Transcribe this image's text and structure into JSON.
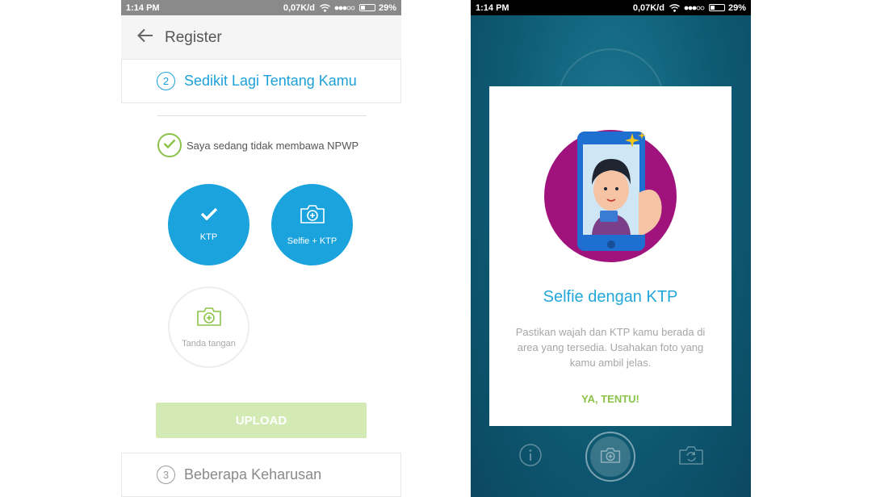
{
  "status_bar": {
    "time": "1:14 PM",
    "speed": "0,07K/d",
    "battery": "29%"
  },
  "register": {
    "title": "Register",
    "step2": {
      "number": "2",
      "title": "Sedikit Lagi Tentang Kamu"
    },
    "npwp_label": "Saya sedang tidak membawa NPWP",
    "buttons": {
      "ktp": "KTP",
      "selfie": "Selfie + KTP",
      "signature": "Tanda tangan"
    },
    "upload_label": "UPLOAD",
    "step3": {
      "number": "3",
      "title": "Beberapa Keharusan"
    }
  },
  "dialog": {
    "title": "Selfie dengan KTP",
    "body": "Pastikan wajah dan KTP kamu berada di area yang tersedia. Usahakan foto yang kamu ambil jelas.",
    "action": "YA, TENTU!"
  },
  "colors": {
    "accent": "#1ba3dd",
    "green": "#8bc34a",
    "upload_disabled": "#d3eab5",
    "camera_bg": "#0d5670",
    "illustration_circle": "#a0127c"
  },
  "icons": [
    "back-arrow-icon",
    "check-icon",
    "camera-plus-icon",
    "info-icon",
    "shutter-camera-icon",
    "switch-camera-icon",
    "wifi-icon",
    "signal-icon",
    "battery-icon"
  ]
}
